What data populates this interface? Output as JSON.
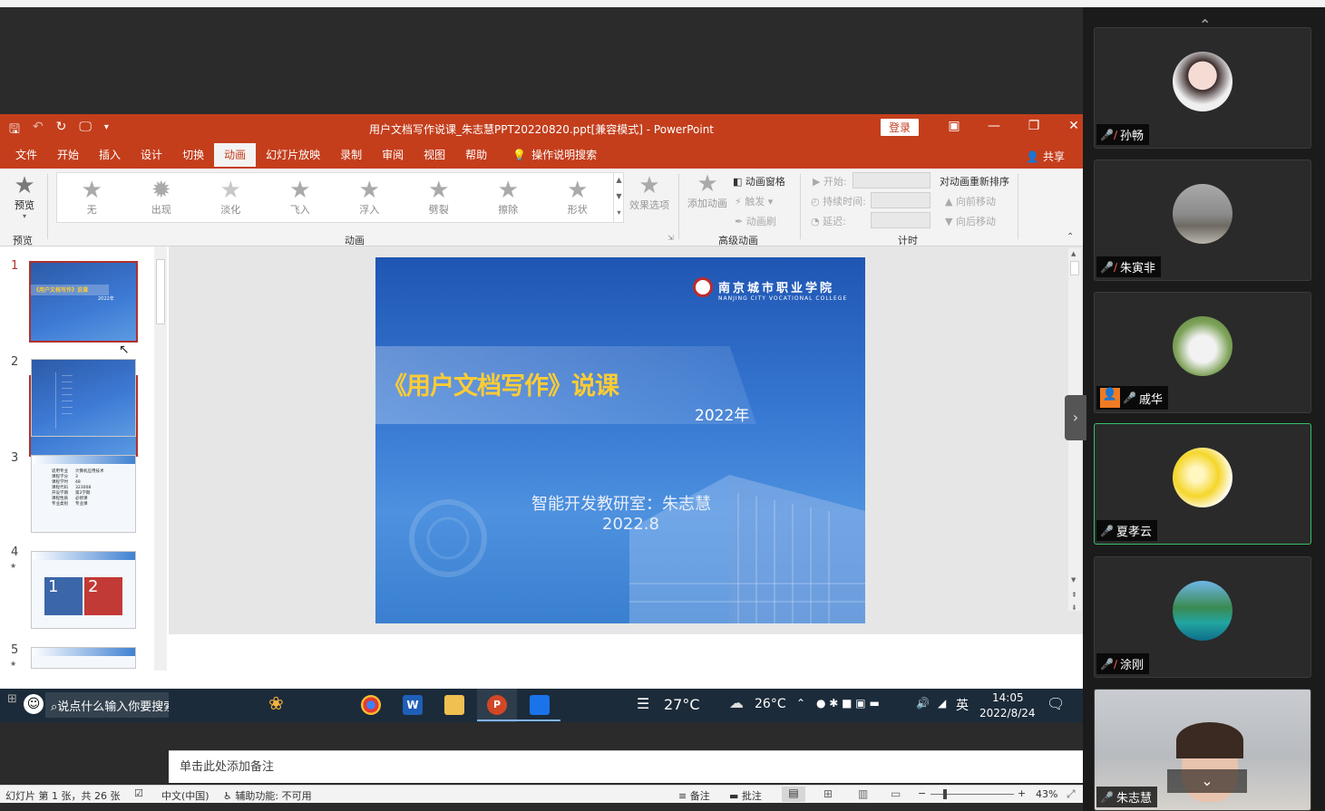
{
  "window": {
    "title": "用户文档写作说课_朱志慧PPT20220820.ppt[兼容模式]  -  PowerPoint",
    "login": "登录"
  },
  "tabs": [
    "文件",
    "开始",
    "插入",
    "设计",
    "切换",
    "动画",
    "幻灯片放映",
    "录制",
    "审阅",
    "视图",
    "帮助"
  ],
  "active_tab": "动画",
  "tell_me": "操作说明搜索",
  "share": "共享",
  "ribbon": {
    "preview": {
      "label": "预览",
      "group": "预览"
    },
    "animations": [
      "无",
      "出现",
      "淡化",
      "飞入",
      "浮入",
      "劈裂",
      "擦除",
      "形状"
    ],
    "effect_options": "效果选项",
    "group_animation": "动画",
    "add_animation": "添加动画",
    "animation_pane": "动画窗格",
    "trigger": "触发",
    "painter": "动画刷",
    "group_advanced": "高级动画",
    "start": "开始:",
    "duration": "持续时间:",
    "delay": "延迟:",
    "reorder": "对动画重新排序",
    "move_earlier": "向前移动",
    "move_later": "向后移动",
    "group_timing": "计时"
  },
  "thumbnails": [
    {
      "num": "1",
      "title": "《用户文档写作》说课",
      "sub": "2022年"
    },
    {
      "num": "2"
    },
    {
      "num": "3",
      "rows": [
        [
          "适用专业",
          "计算机应用技术"
        ],
        [
          "课程学分",
          "3"
        ],
        [
          "课程学时",
          "48"
        ],
        [
          "课程代码",
          "323008"
        ],
        [
          "开设学期",
          "第2学期"
        ],
        [
          "课程性质",
          "必修课"
        ],
        [
          "专业类别",
          "专业课"
        ]
      ]
    },
    {
      "num": "4",
      "boxes": [
        "1",
        "2"
      ]
    },
    {
      "num": "5"
    }
  ],
  "slide": {
    "logo_cn": "南京城市职业学院",
    "logo_en": "NANJING CITY VOCATIONAL COLLEGE",
    "title": "《用户文档写作》说课",
    "year": "2022年",
    "author": "智能开发教研室：朱志慧",
    "date": "2022.8"
  },
  "notes": "单击此处添加备注",
  "status": {
    "slide_info": "幻灯片 第 1 张，共 26 张",
    "language": "中文(中国)",
    "accessibility": "辅助功能: 不可用",
    "notes_btn": "备注",
    "comments_btn": "批注",
    "zoom": "43%"
  },
  "taskbar": {
    "search": "说点什么输入你要搜索的内容",
    "weather1": "27°C",
    "weather2": "26°C",
    "ime": "英",
    "time": "14:05",
    "date": "2022/8/24"
  },
  "participants": [
    {
      "name": "孙畅",
      "muted": true
    },
    {
      "name": "朱寅非",
      "muted": true
    },
    {
      "name": "戚华",
      "muted": false
    },
    {
      "name": "夏孝云",
      "muted": false
    },
    {
      "name": "涂刚",
      "muted": true
    },
    {
      "name": "朱志慧",
      "muted": false
    }
  ],
  "colors": {
    "ppt_accent": "#c43e1c",
    "speaking": "#35c06a"
  }
}
